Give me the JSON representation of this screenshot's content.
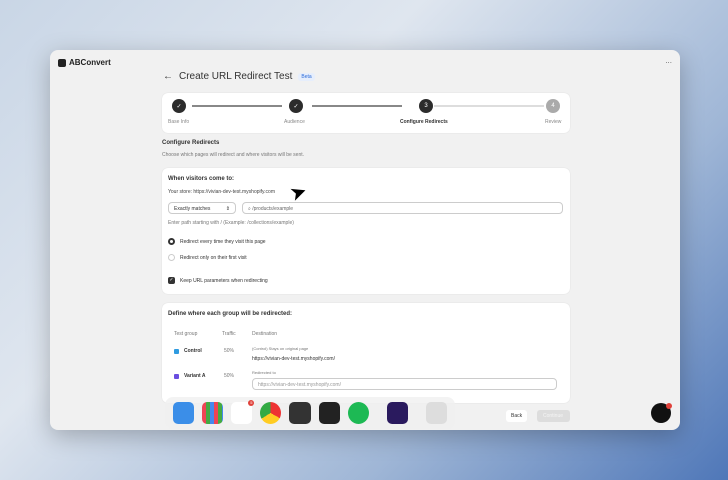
{
  "app": {
    "name": "ABConvert",
    "menu": "..."
  },
  "page": {
    "title": "Create URL Redirect Test",
    "badge": "Beta",
    "back": "←"
  },
  "steps": [
    {
      "label": "Base Info",
      "mark": "✓"
    },
    {
      "label": "Audience",
      "mark": "✓"
    },
    {
      "label": "Configure Redirects",
      "mark": "3"
    },
    {
      "label": "Review",
      "mark": "4"
    }
  ],
  "section": {
    "title": "Configure Redirects",
    "subtitle": "Choose which pages will redirect and where visitors will be sent."
  },
  "when": {
    "title": "When visitors come to:",
    "store": "Your store: https://vivian-dev-test.myshopify.com",
    "match": "Exactly matches",
    "path_value": "/products/example",
    "hint": "Enter path starting with / (Example: /collections/example)",
    "radio1": "Redirect every time they visit this page",
    "radio2": "Redirect only on their first visit",
    "checkbox": "Keep URL parameters when redirecting"
  },
  "groups": {
    "title": "Define where each group will be redirected:",
    "headers": [
      "Test group",
      "Traffic",
      "Destination"
    ],
    "rows": [
      {
        "name": "Control",
        "color": "#2f9be0",
        "traffic": "50%",
        "note": "(Control) Stays on original page",
        "dest": "https://vivian-dev-test.myshopify.com/"
      },
      {
        "name": "Variant A",
        "color": "#6a4ee0",
        "traffic": "50%",
        "note": "Redirected to",
        "placeholder": "https://vivian-dev-test.myshopify.com/"
      }
    ]
  },
  "footer": {
    "back": "Back",
    "continue": "Continue"
  },
  "dock": {
    "slack_badge": "5"
  }
}
